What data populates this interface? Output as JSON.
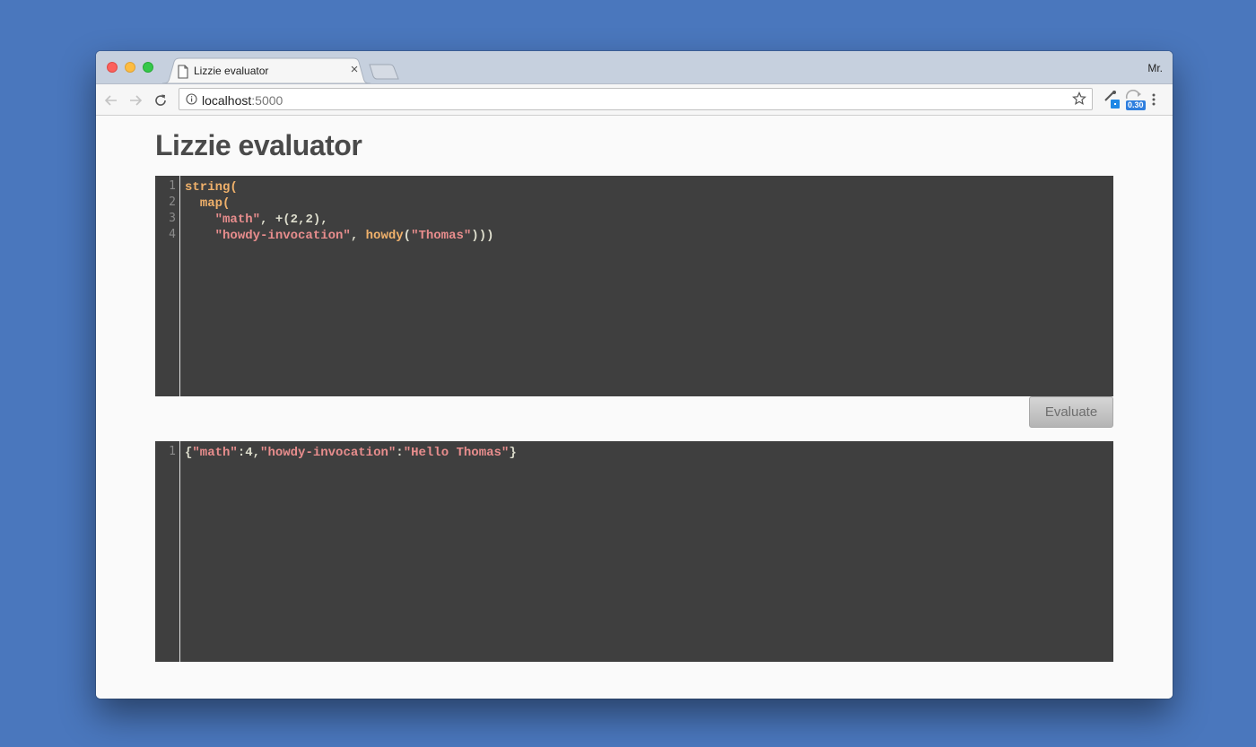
{
  "browser": {
    "tab_title": "Lizzie evaluator",
    "tab_close": "×",
    "profile_name": "Mr.",
    "url_host": "localhost",
    "url_port": ":5000",
    "extension_badge": "0.30"
  },
  "page": {
    "title": "Lizzie evaluator",
    "evaluate_label": "Evaluate"
  },
  "input_editor": {
    "line_numbers": [
      "1",
      "2",
      "3",
      "4"
    ],
    "lines": [
      [
        {
          "t": "fn",
          "v": "string("
        }
      ],
      [
        {
          "t": "plain",
          "v": "  "
        },
        {
          "t": "fn",
          "v": "map("
        }
      ],
      [
        {
          "t": "plain",
          "v": "    "
        },
        {
          "t": "str",
          "v": "\"math\""
        },
        {
          "t": "plain",
          "v": ", +(2,2),"
        }
      ],
      [
        {
          "t": "plain",
          "v": "    "
        },
        {
          "t": "str",
          "v": "\"howdy-invocation\""
        },
        {
          "t": "plain",
          "v": ", "
        },
        {
          "t": "fn",
          "v": "howdy"
        },
        {
          "t": "plain",
          "v": "("
        },
        {
          "t": "str",
          "v": "\"Thomas\""
        },
        {
          "t": "plain",
          "v": ")))"
        }
      ]
    ]
  },
  "output_editor": {
    "line_numbers": [
      "1"
    ],
    "lines": [
      [
        {
          "t": "plain",
          "v": "{"
        },
        {
          "t": "str",
          "v": "\"math\""
        },
        {
          "t": "plain",
          "v": ":4,"
        },
        {
          "t": "str",
          "v": "\"howdy-invocation\""
        },
        {
          "t": "plain",
          "v": ":"
        },
        {
          "t": "str",
          "v": "\"Hello Thomas\""
        },
        {
          "t": "plain",
          "v": "}"
        }
      ]
    ]
  },
  "colors": {
    "desktop_bg": "#4a77bd",
    "editor_bg": "#3f3f3f",
    "token_function": "#f0b16b",
    "token_string": "#e88d8d",
    "token_plain": "#dcdccc"
  }
}
